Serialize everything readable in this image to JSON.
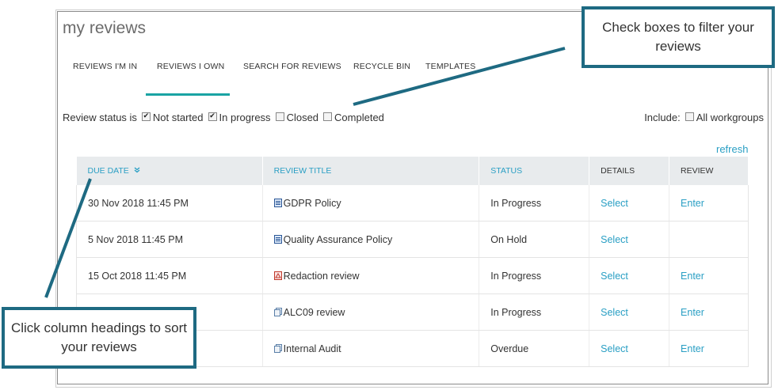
{
  "page": {
    "title": "my reviews"
  },
  "tabs": [
    {
      "label": "REVIEWS I'M IN"
    },
    {
      "label": "REVIEWS I OWN",
      "active": true
    },
    {
      "label": "SEARCH FOR REVIEWS"
    },
    {
      "label": "RECYCLE BIN"
    },
    {
      "label": "TEMPLATES"
    }
  ],
  "filters": {
    "label": "Review status is",
    "options": [
      {
        "label": "Not started",
        "checked": true
      },
      {
        "label": "In progress",
        "checked": true
      },
      {
        "label": "Closed",
        "checked": false
      },
      {
        "label": "Completed",
        "checked": false
      }
    ],
    "include_label": "Include:",
    "all_workgroups": {
      "label": "All workgroups",
      "checked": false
    },
    "refresh": "refresh"
  },
  "table": {
    "columns": [
      "DUE DATE",
      "REVIEW TITLE",
      "STATUS",
      "DETAILS",
      "REVIEW"
    ],
    "sort_icon": "double-chevron-down-icon",
    "rows": [
      {
        "due": "30 Nov 2018 11:45 PM",
        "icon": "word-doc-icon",
        "title": "GDPR Policy",
        "status": "In Progress",
        "details": "Select",
        "review": "Enter"
      },
      {
        "due": "5 Nov 2018 11:45 PM",
        "icon": "word-doc-icon",
        "title": "Quality Assurance Policy",
        "status": "On Hold",
        "details": "Select",
        "review": ""
      },
      {
        "due": "15 Oct 2018 11:45 PM",
        "icon": "pdf-doc-icon",
        "title": "Redaction review",
        "status": "In Progress",
        "details": "Select",
        "review": "Enter"
      },
      {
        "due": "",
        "icon": "multi-doc-icon",
        "title": "ALC09 review",
        "status": "In Progress",
        "details": "Select",
        "review": "Enter"
      },
      {
        "due": "",
        "icon": "multi-doc-icon",
        "title": "Internal Audit",
        "status": "Overdue",
        "details": "Select",
        "review": "Enter"
      }
    ]
  },
  "callouts": {
    "filter": "Check boxes to filter your reviews",
    "sort": "Click column headings to sort your reviews"
  },
  "colors": {
    "accent": "#2a9fc4",
    "tab_underline": "#1aa3a3",
    "callout_border": "#1e6a82"
  }
}
